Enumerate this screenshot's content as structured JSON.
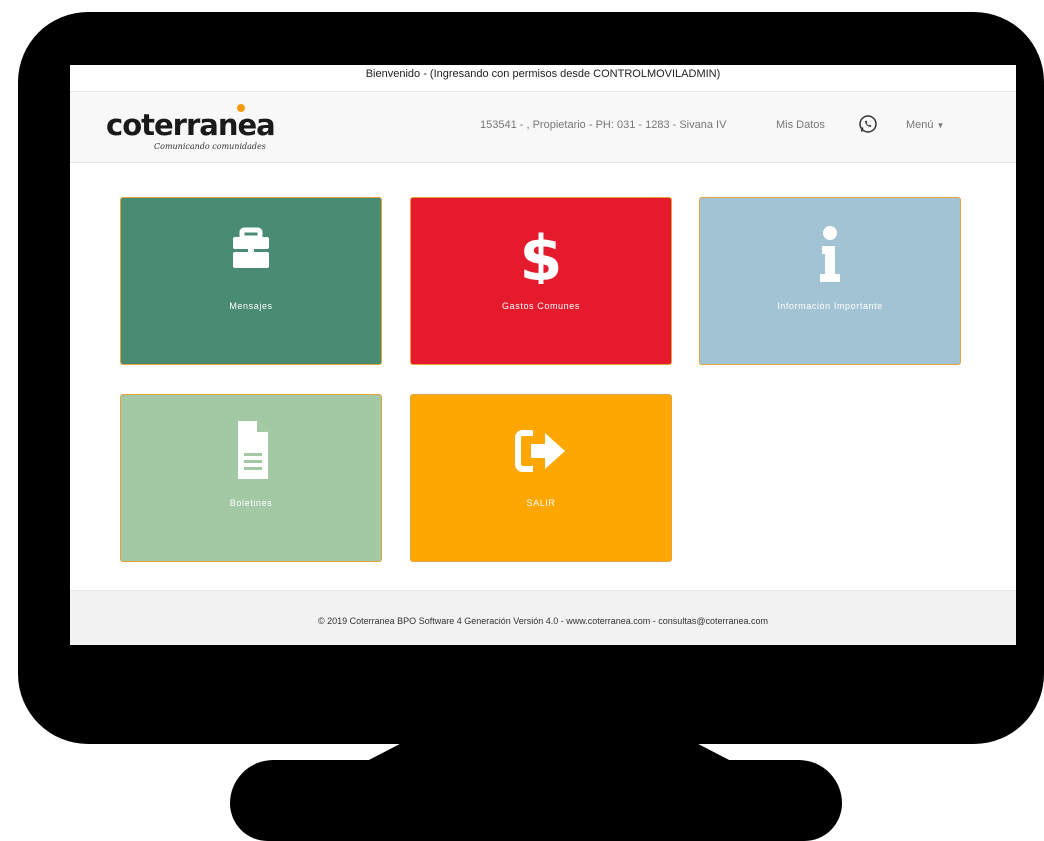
{
  "welcome": "Bienvenido - (Ingresando con permisos desde CONTROLMOVILADMIN)",
  "brand": {
    "name": "coterranea",
    "tagline": "Comunicando comunidades"
  },
  "nav": {
    "user_info": "153541 - , Propietario - PH: 031 - 1283 - Sivana IV",
    "mis_datos": "Mis Datos",
    "menu": "Menú"
  },
  "tiles": [
    {
      "label": "Mensajes",
      "icon": "briefcase-icon",
      "color": "#4a8b73"
    },
    {
      "label": "Gastos Comunes",
      "icon": "dollar-icon",
      "color": "#e51b2d"
    },
    {
      "label": "Información Importante",
      "icon": "info-icon",
      "color": "#a2c3d4"
    },
    {
      "label": "Boletines",
      "icon": "document-icon",
      "color": "#a2c8a4"
    },
    {
      "label": "SALIR",
      "icon": "sign-out-icon",
      "color": "#fea702"
    }
  ],
  "footer": "© 2019 Coterranea BPO Software 4 Generación Versión 4.0 - www.coterranea.com - consultas@coterranea.com"
}
